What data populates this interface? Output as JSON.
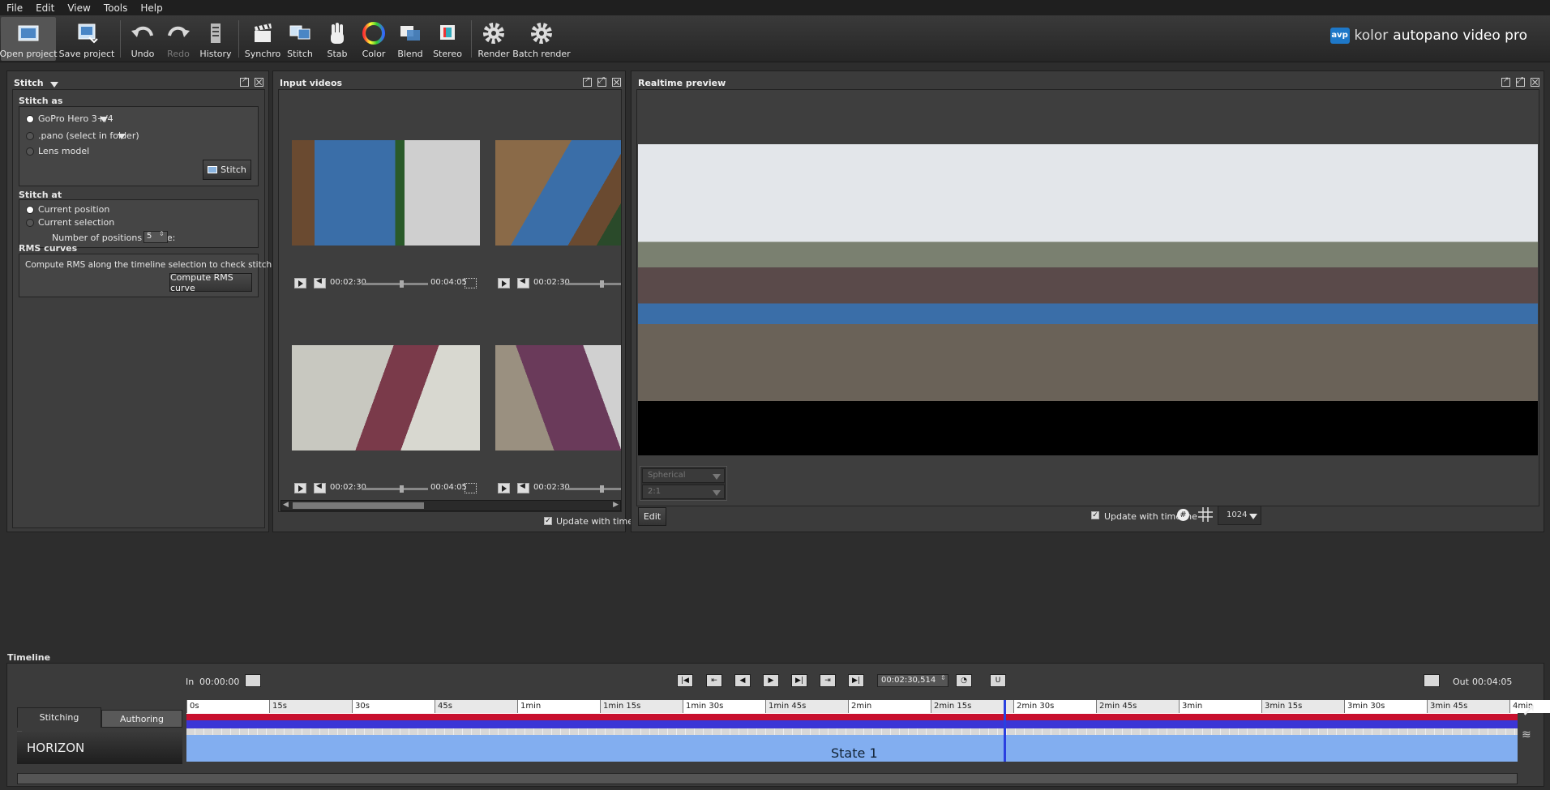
{
  "menu": [
    "File",
    "Edit",
    "View",
    "Tools",
    "Help"
  ],
  "toolbar": {
    "open_project": "Open project",
    "save_project": "Save project",
    "undo": "Undo",
    "redo": "Redo",
    "history": "History",
    "synchro": "Synchro",
    "stitch": "Stitch",
    "stab": "Stab",
    "color": "Color",
    "blend": "Blend",
    "stereo": "Stereo",
    "render": "Render",
    "batch_render": "Batch render"
  },
  "brand": {
    "logo": "avp",
    "name_part1": "kolor",
    "name_part2": "autopano video pro"
  },
  "stitch_panel": {
    "title": "Stitch",
    "stitch_as": {
      "heading": "Stitch as",
      "options": [
        "GoPro Hero 3+/4",
        ".pano (select in folder)",
        "Lens model"
      ],
      "selected": 0,
      "button": "Stitch"
    },
    "stitch_at": {
      "heading": "Stitch at",
      "options": [
        "Current position",
        "Current selection"
      ],
      "selected": 0,
      "positions_label": "Number of positions to use:",
      "positions_value": "5"
    },
    "rms": {
      "heading": "RMS curves",
      "description": "Compute RMS along the timeline selection to check stitching quality.",
      "button": "Compute RMS curve"
    }
  },
  "input_videos": {
    "title": "Input videos",
    "cells": [
      {
        "current": "00:02:30",
        "duration": "00:04:05",
        "progress": 0.61
      },
      {
        "current": "00:02:30",
        "duration": "",
        "progress": 0.61
      },
      {
        "current": "00:02:30",
        "duration": "00:04:05",
        "progress": 0.61
      },
      {
        "current": "00:02:30",
        "duration": "",
        "progress": 0.61
      }
    ],
    "update_label": "Update with timeline",
    "update_checked": true
  },
  "preview": {
    "title": "Realtime preview",
    "projection": "Spherical",
    "ratio": "2:1",
    "edit_button": "Edit",
    "update_label": "Update with timeline",
    "update_checked": true,
    "resolution": "1024"
  },
  "timeline": {
    "heading": "Timeline",
    "in_label": "In",
    "in_time": "00:00:00",
    "out_label": "Out",
    "out_time": "00:04:05",
    "current_time": "00:02:30,514",
    "tabs": [
      "Stitching",
      "Authoring"
    ],
    "active_tab": 0,
    "track_name": "HORIZON",
    "state_label": "State 1",
    "ticks": [
      "0s",
      "15s",
      "30s",
      "45s",
      "1min",
      "1min 15s",
      "1min 30s",
      "1min 45s",
      "2min",
      "2min 15s",
      "2min 30s",
      "2min 45s",
      "3min",
      "3min 15s",
      "3min 30s",
      "3min 45s",
      "4min"
    ],
    "cursor_fraction": 0.614
  }
}
